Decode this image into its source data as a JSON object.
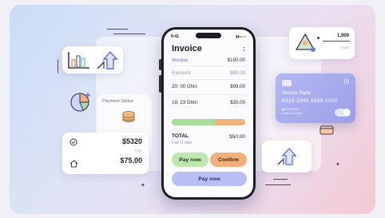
{
  "phone": {
    "status_time": "9:41",
    "status_icons": "▮▮ ◕ ▭",
    "title": "Invoice",
    "menu_icon": "more-icon",
    "menu_glyph": ":",
    "rows": [
      {
        "label": "Invoice:",
        "value": "$190.00"
      },
      {
        "label": "Ranount",
        "value": "$80.00"
      },
      {
        "label": "20: 00 Ghin",
        "value": "$99.00"
      },
      {
        "label": "18: 23 Ghin",
        "value": "$30.00"
      }
    ],
    "progress": 0.6,
    "progress_colors": {
      "paid": "#a8dd9c",
      "remaining": "#f0b37c"
    },
    "total_label": "TOTAL",
    "total_sub": "Due l3 dalo",
    "total_value": "$50.00",
    "pay_now_label": "Pay now",
    "confirm_label": "Confirm",
    "pay_now_wide_label": "Pay now"
  },
  "credit_card": {
    "name": "Invoice Narie",
    "number": "9215  2345  5668  5010",
    "small_line_1": "▮▮   203 00/24",
    "small_line_2": "Orderin 00.0/13"
  },
  "payment_status": {
    "label": "Payment Status"
  },
  "amount_card": {
    "amount_1": "$5320",
    "sub": "Trom",
    "amount_2": "$75.00"
  },
  "top_right_card": {
    "value": "1,900",
    "sub": "Trom"
  },
  "icons": {
    "bar_chart": "bar-chart-icon",
    "arrow_up": "arrow-up-icon",
    "pie_chart": "pie-chart-icon",
    "coins": "coin-stack-icon",
    "check": "check-circle-icon",
    "home": "home-icon",
    "triangle": "triangle-chart-icon",
    "sparkle": "sparkle-icon",
    "card_small": "card-icon",
    "wifi": "nfc-icon"
  },
  "colors": {
    "accent_blue": "#5a6ee0",
    "card_purple": "#a8abed",
    "green": "#bfe8b0",
    "orange": "#f3b07a"
  }
}
